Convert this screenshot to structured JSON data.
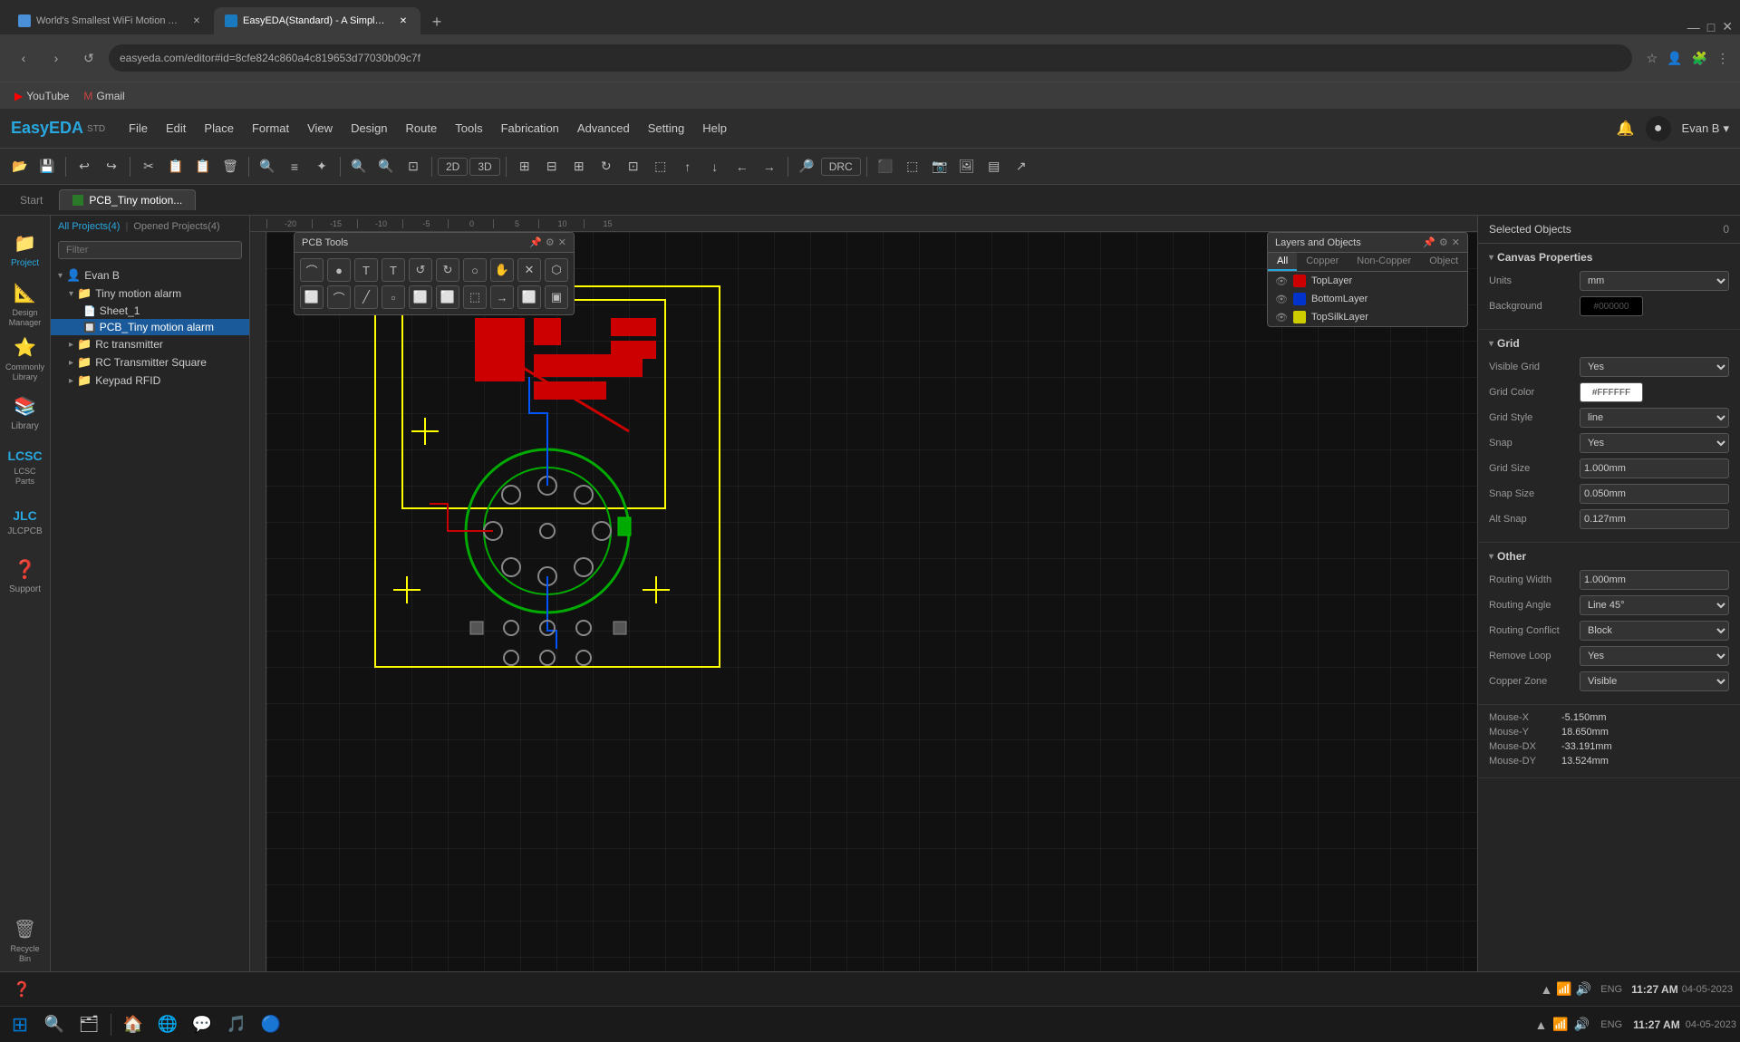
{
  "browser": {
    "tabs": [
      {
        "id": "tab1",
        "label": "World's Smallest WiFi Motion Al...",
        "favicon_type": "page",
        "active": false
      },
      {
        "id": "tab2",
        "label": "EasyEDA(Standard) - A Simple an...",
        "favicon_type": "easyeda",
        "active": true
      }
    ],
    "add_tab_label": "+",
    "address": "easyeda.com/editor#id=8cfe824c860a4c819653d77030b09c7f",
    "bookmarks": [
      "YouTube",
      "Gmail"
    ]
  },
  "app": {
    "logo": "EasyEDA",
    "logo_suffix": "STD",
    "menu": [
      "File",
      "Edit",
      "Place",
      "Format",
      "View",
      "Design",
      "Route",
      "Tools",
      "Fabrication",
      "Advanced",
      "Setting",
      "Help"
    ],
    "user_name": "Evan B",
    "notification_icon": "🔔",
    "toolbar": {
      "buttons": [
        "📂",
        "💾",
        "↩",
        "↪",
        "✂",
        "📋",
        "🗑",
        "🔍",
        "≡",
        "✦",
        "🔍+",
        "🔍-",
        "⊡",
        "2D",
        "3D",
        "DRC"
      ]
    },
    "project_tabs": [
      {
        "label": "Start",
        "active": false
      },
      {
        "label": "PCB_Tiny motion...",
        "active": true,
        "icon": true
      }
    ]
  },
  "left_sidebar": {
    "items": [
      {
        "id": "project",
        "label": "Project",
        "icon": "📁"
      },
      {
        "id": "design-manager",
        "label": "Design\nManager",
        "icon": "📐"
      },
      {
        "id": "library",
        "label": "Library",
        "icon": "📚"
      },
      {
        "id": "lcsc-parts",
        "label": "LCSC\nParts",
        "icon": "🔌"
      },
      {
        "id": "jlcpcb",
        "label": "JLCPCB",
        "icon": "🔧"
      },
      {
        "id": "support",
        "label": "Support",
        "icon": "❓"
      }
    ],
    "bottom_items": [
      {
        "id": "recycle-bin",
        "label": "Recycle\nBin",
        "icon": "🗑"
      }
    ]
  },
  "project_panel": {
    "tabs": [
      "All Projects(4)",
      "Opened Projects(4)"
    ],
    "active_tab": "All Projects(4)",
    "filter_placeholder": "Filter",
    "tree": [
      {
        "id": "root",
        "label": "Evan B",
        "indent": 0,
        "type": "user",
        "expanded": true
      },
      {
        "id": "folder1",
        "label": "Tiny motion alarm",
        "indent": 1,
        "type": "folder",
        "expanded": true
      },
      {
        "id": "sheet1",
        "label": "Sheet_1",
        "indent": 2,
        "type": "file"
      },
      {
        "id": "pcb1",
        "label": "PCB_Tiny motion alarm",
        "indent": 2,
        "type": "pcb",
        "selected": true
      },
      {
        "id": "folder2",
        "label": "Rc transmitter",
        "indent": 1,
        "type": "folder",
        "expanded": false
      },
      {
        "id": "folder3",
        "label": "RC Transmitter Square",
        "indent": 1,
        "type": "folder",
        "expanded": false
      },
      {
        "id": "folder4",
        "label": "Keypad RFID",
        "indent": 1,
        "type": "folder",
        "expanded": false
      }
    ]
  },
  "pcb_tools": {
    "title": "PCB Tools",
    "tools": [
      "⌒",
      "●",
      "T",
      "T",
      "↺",
      "↻",
      "○",
      "✋",
      "✕",
      "⬡",
      "⬜",
      "⌒",
      "╱",
      "▫",
      "⬜",
      "⬜",
      "⬚",
      "→",
      "⬜",
      "▣"
    ]
  },
  "layers": {
    "title": "Layers and Objects",
    "tabs": [
      "All",
      "Copper",
      "Non-Copper",
      "Object"
    ],
    "active_tab": "All",
    "layers": [
      {
        "name": "TopLayer",
        "color": "red",
        "visible": true
      },
      {
        "name": "BottomLayer",
        "color": "blue",
        "visible": true
      },
      {
        "name": "TopSilkLayer",
        "color": "yellow",
        "visible": true
      }
    ]
  },
  "right_panel": {
    "title": "Selected Objects",
    "count": "0",
    "canvas_properties_title": "Canvas Properties",
    "sections": {
      "units_label": "Units",
      "units_value": "mm",
      "background_label": "Background",
      "background_value": "#000000",
      "grid_section": "Grid",
      "visible_grid_label": "Visible Grid",
      "visible_grid_value": "Yes",
      "grid_color_label": "Grid Color",
      "grid_color_value": "#FFFFFF",
      "grid_style_label": "Grid Style",
      "grid_style_value": "line",
      "snap_label": "Snap",
      "snap_value": "Yes",
      "grid_size_label": "Grid Size",
      "grid_size_value": "1.000mm",
      "snap_size_label": "Snap Size",
      "snap_size_value": "0.050mm",
      "alt_snap_label": "Alt Snap",
      "alt_snap_value": "0.127mm",
      "other_section": "Other",
      "routing_width_label": "Routing Width",
      "routing_width_value": "1.000mm",
      "routing_angle_label": "Routing Angle",
      "routing_angle_value": "Line 45°",
      "routing_conflict_label": "Routing Conflict",
      "routing_conflict_value": "Block",
      "remove_loop_label": "Remove Loop",
      "remove_loop_value": "Yes",
      "copper_zone_label": "Copper Zone",
      "copper_zone_value": "Visible",
      "mouse_x_label": "Mouse-X",
      "mouse_x_value": "-5.150mm",
      "mouse_y_label": "Mouse-Y",
      "mouse_y_value": "18.650mm",
      "mouse_dx_label": "Mouse-DX",
      "mouse_dx_value": "-33.191mm",
      "mouse_dy_label": "Mouse-DY",
      "mouse_dy_value": "13.524mm"
    }
  },
  "status_bar": {
    "time": "11:27 AM",
    "date": "04-05-2023",
    "lang": "ENG"
  },
  "taskbar": {
    "start_icon": "⊞",
    "items": [
      "🗂",
      "🏠",
      "🌐",
      "💬",
      "🎵",
      "🔵"
    ]
  }
}
